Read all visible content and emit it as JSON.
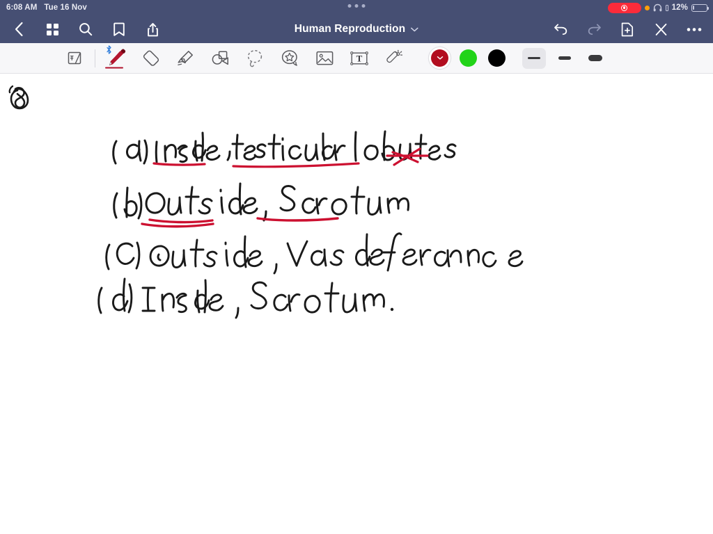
{
  "status_bar": {
    "time": "6:08 AM",
    "date": "Tue 16 Nov",
    "battery_percent": "12%",
    "recording_indicator": "screen-recording-active",
    "focus_dot": "orange-status-dot",
    "headphones": "headphones-connected"
  },
  "nav_bar": {
    "title": "Human Reproduction",
    "back_label": "back-chevron",
    "thumbnails_label": "page-thumbnails",
    "search_label": "search",
    "bookmark_label": "bookmark",
    "share_label": "share",
    "undo_label": "undo",
    "redo_label": "redo",
    "add_page_label": "add-page",
    "close_label": "close",
    "more_label": "more-options"
  },
  "toolbar": {
    "tools": [
      {
        "id": "page-flip",
        "label": "Page flip",
        "selected": false
      },
      {
        "id": "pen",
        "label": "Pen",
        "selected": true,
        "bluetooth": true,
        "color": "#b01030"
      },
      {
        "id": "eraser",
        "label": "Eraser",
        "selected": false
      },
      {
        "id": "highlighter",
        "label": "Highlighter",
        "selected": false
      },
      {
        "id": "shapes",
        "label": "Shapes",
        "selected": false
      },
      {
        "id": "lasso",
        "label": "Lasso",
        "selected": false
      },
      {
        "id": "sticker",
        "label": "Sticker",
        "selected": false
      },
      {
        "id": "image",
        "label": "Image",
        "selected": false
      },
      {
        "id": "text-box",
        "label": "Text box",
        "selected": false,
        "glyph": "T"
      },
      {
        "id": "laser-pointer",
        "label": "Laser pointer",
        "selected": false
      }
    ],
    "colors": [
      {
        "id": "red",
        "hex": "#b20d1f",
        "selected": true
      },
      {
        "id": "green",
        "hex": "#22d319",
        "selected": false
      },
      {
        "id": "black",
        "hex": "#000000",
        "selected": false
      }
    ],
    "stroke_widths": [
      {
        "id": "thin",
        "size": 3.2,
        "selected": true
      },
      {
        "id": "medium",
        "size": 5.0,
        "selected": false
      },
      {
        "id": "thick",
        "size": 9.0,
        "selected": false
      }
    ]
  },
  "canvas": {
    "question_number": "8",
    "ink_colors": {
      "black": "#1a1a1a",
      "red": "#cc1030"
    },
    "handwriting": [
      {
        "id": "option-a",
        "label": "(a) Inside, testicular lobules",
        "text": "(a) Inside , testicular lobutes",
        "color": "black",
        "annotations": [
          {
            "type": "underline",
            "color": "red",
            "target": "Inside"
          },
          {
            "type": "underline",
            "color": "red",
            "target": "testicular lobutes"
          },
          {
            "type": "cross-mark",
            "color": "red",
            "target": "end-of-line"
          }
        ]
      },
      {
        "id": "option-b",
        "label": "(b) Outside, Scrotum",
        "text": "(b) Out side, Scrotum",
        "color": "black",
        "annotations": [
          {
            "type": "double-underline",
            "color": "red",
            "target": "Out side"
          },
          {
            "type": "underline",
            "color": "red",
            "target": "Scrotum"
          }
        ]
      },
      {
        "id": "option-c",
        "label": "(C) Out side, Vas deferance",
        "text": "(C) Out side , Vas deferance",
        "color": "black",
        "annotations": []
      },
      {
        "id": "option-d",
        "label": "(d) Inside, Scrotum.",
        "text": "(d) Inside , Scrotum.",
        "color": "black",
        "annotations": []
      }
    ]
  }
}
